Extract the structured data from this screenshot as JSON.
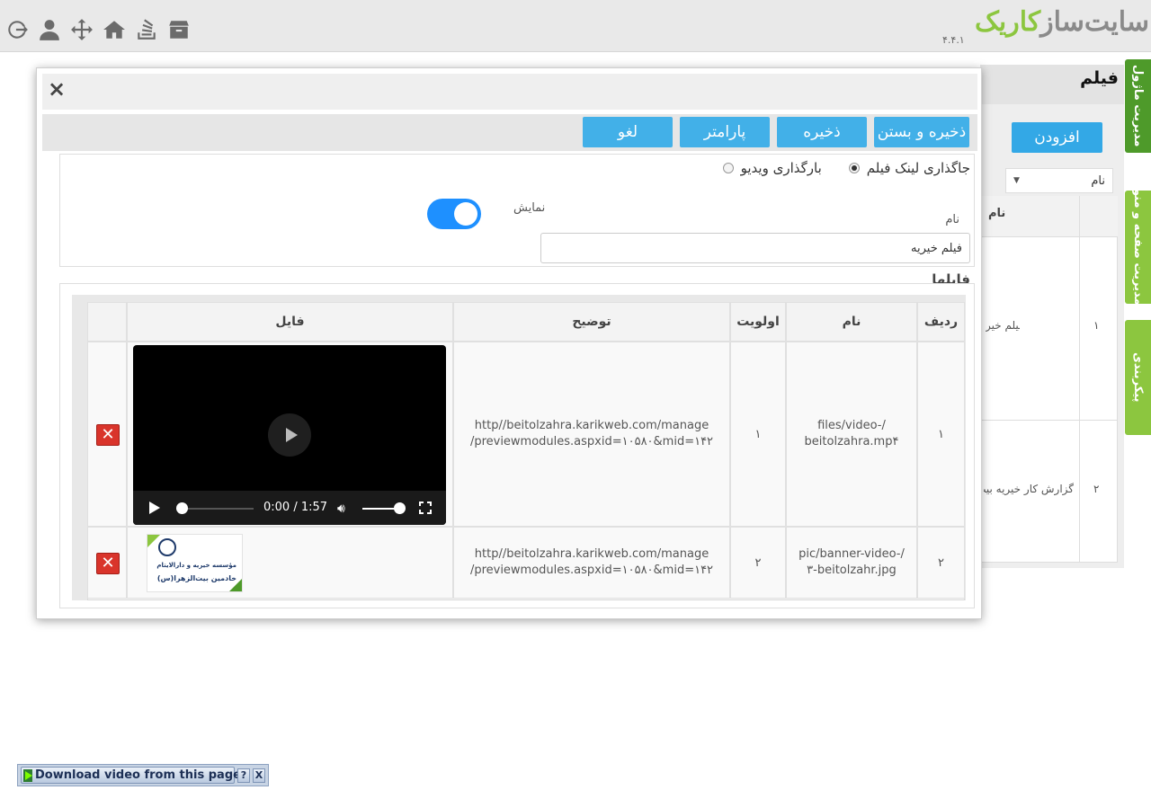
{
  "header": {
    "logo_gray": "سایت‌ساز",
    "logo_green": "کاریک",
    "version": "۴.۴.۱",
    "tool_icons": [
      "logout-icon",
      "user-icon",
      "move-icon",
      "home-icon",
      "stack-icon",
      "archive-icon"
    ]
  },
  "side_tabs": [
    {
      "label": "مدیریت ماژول",
      "active": true
    },
    {
      "label": "مدیریت صفحه و منو",
      "active": false
    },
    {
      "label": "پیکربندی",
      "active": false
    }
  ],
  "background_page": {
    "title": "فیلم",
    "add_button": "افزودن",
    "filter_select": "نام",
    "column_name": "نام",
    "rows": [
      {
        "index": "۱",
        "name": "فیلم خیر"
      },
      {
        "index": "۲",
        "name": "گزارش کار خیریه بیت ا"
      }
    ]
  },
  "modal": {
    "close_symbol": "×",
    "buttons": {
      "save_close": "ذخیره و بستن",
      "save": "ذخیره",
      "parameter": "پارامتر",
      "cancel": "لغو"
    },
    "radio": {
      "link_label": "جاگذاری لینک فیلم",
      "upload_label": "بارگذاری ویدیو",
      "selected": "link"
    },
    "name_label": "نام",
    "name_value": "فیلم خیریه",
    "show_label": "نمایش",
    "show_enabled": true,
    "files_title": "فایلها",
    "files_table": {
      "headers": {
        "row": "ردیف",
        "name": "نام",
        "priority": "اولویت",
        "description": "توضیح",
        "file": "فایل"
      },
      "rows": [
        {
          "row": "۱",
          "name": "files/video-/\nbeitolzahra.mp۴",
          "priority": "۱",
          "description": "http//beitolzahra.karikweb.com/manage\n/previewmodules.aspxid=۱۰۵۸۰&mid=۱۴۲",
          "file_type": "video",
          "video_time": "0:00 / 1:57"
        },
        {
          "row": "۲",
          "name": "pic/banner-video-/\n۳-beitolzahr.jpg",
          "priority": "۲",
          "description": "http//beitolzahra.karikweb.com/manage\n/previewmodules.aspxid=۱۰۵۸۰&mid=۱۴۲",
          "file_type": "image",
          "banner_line1": "مؤسسه خیریه و دارالایتام",
          "banner_line2": "خادمین بیت‌الزهرا(س)"
        }
      ]
    }
  },
  "download_bar": {
    "label": "Download video from this page",
    "help": "?",
    "close": "X"
  },
  "colors": {
    "brand_green": "#8cc63f",
    "button_blue": "#42b0e8",
    "toggle_blue": "#1e90ff",
    "delete_red": "#d9342b"
  }
}
